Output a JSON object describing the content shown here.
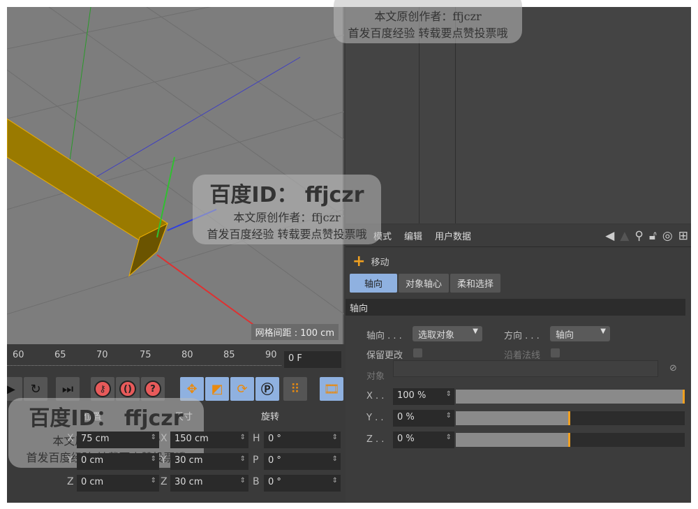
{
  "viewport": {
    "grid_spacing": "网格间距 : 100 cm"
  },
  "attributes": {
    "menu": [
      "模式",
      "编辑",
      "用户数据"
    ],
    "tool_name": "移动",
    "tabs": [
      "轴向",
      "对象轴心",
      "柔和选择"
    ],
    "section": "轴向",
    "axis_label": "轴向 . . .",
    "axis_value": "选取对象",
    "direction_label": "方向 . . .",
    "direction_value": "轴向",
    "keep_changes": "保留更改",
    "along_normals": "沿着法线",
    "object_label": "对象",
    "x_label": "X . .",
    "x_value": "100 %",
    "x_pct": 100,
    "y_label": "Y . .",
    "y_value": "0 %",
    "y_pct": 50,
    "z_label": "Z . .",
    "z_value": "0 %",
    "z_pct": 50
  },
  "timeline": {
    "ticks": [
      "60",
      "65",
      "70",
      "75",
      "80",
      "85",
      "90"
    ],
    "frame": "0 F"
  },
  "coords": {
    "headers": [
      "位置",
      "尺寸",
      "旋转"
    ],
    "pos": {
      "x": "75 cm",
      "y": "0 cm",
      "z": "0 cm"
    },
    "size": {
      "x": "150 cm",
      "y": "30 cm",
      "z": "30 cm"
    },
    "rot": {
      "h": "0 °",
      "p": "0 °",
      "b": "0 °"
    },
    "axes": [
      "X",
      "Y",
      "Z",
      "H",
      "P",
      "B"
    ]
  },
  "watermark": {
    "id": "百度ID： ffjczr",
    "line1": "本文原创作者：ffjczr",
    "line2": "首发百度经验 转载要点赞投票哦"
  },
  "colors": {
    "accent": "#f0a020",
    "active_tab": "#8fb1e0"
  }
}
